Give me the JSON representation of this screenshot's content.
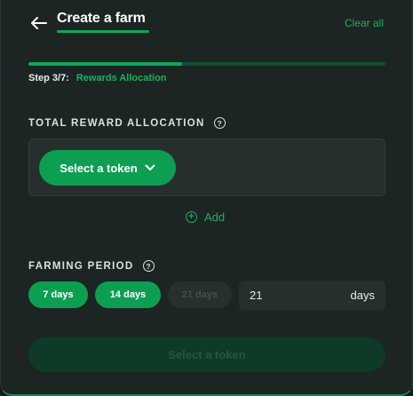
{
  "header": {
    "back_icon": "arrow-left-icon",
    "title": "Create a farm",
    "clear_all": "Clear all"
  },
  "progress": {
    "current_step": 3,
    "total_steps": 7,
    "fraction": 0.43,
    "step_label": "Step 3/7:",
    "step_name": "Rewards Allocation"
  },
  "reward_section": {
    "label": "TOTAL REWARD ALLOCATION",
    "help_icon": "question-circle-icon",
    "select_token_label": "Select a token",
    "chevron_icon": "chevron-down-icon",
    "add_label": "Add",
    "add_icon": "plus-circle-icon"
  },
  "farming_period": {
    "label": "FARMING PERIOD",
    "help_icon": "question-circle-icon",
    "options": [
      {
        "label": "7 days",
        "state": "active"
      },
      {
        "label": "14 days",
        "state": "active"
      },
      {
        "label": "21 days",
        "state": "disabled"
      }
    ],
    "days_value": "21",
    "days_unit": "days"
  },
  "submit": {
    "label": "Select a token",
    "state": "disabled"
  },
  "colors": {
    "accent": "#0c9f52",
    "accent_text": "#18b160",
    "background": "#1c2524",
    "input_background": "#262f2e"
  }
}
